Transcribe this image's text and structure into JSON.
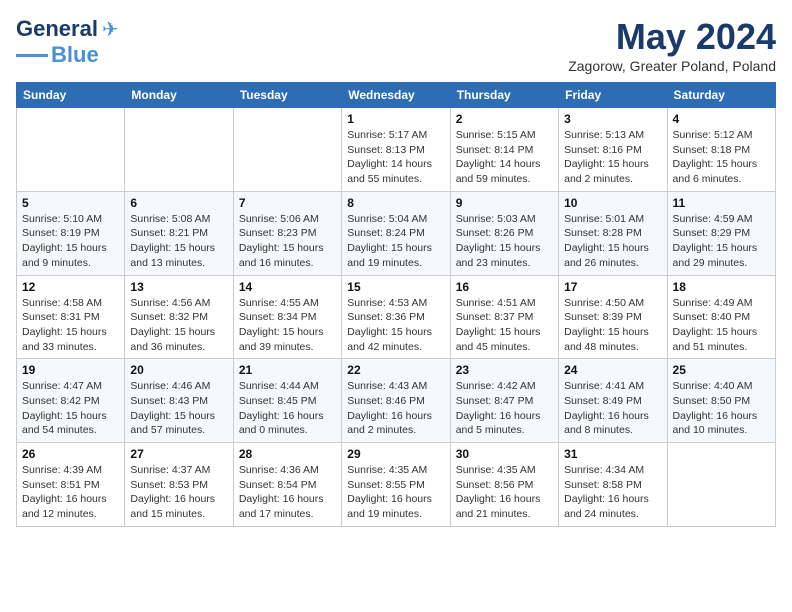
{
  "header": {
    "logo_general": "General",
    "logo_blue": "Blue",
    "month_title": "May 2024",
    "location": "Zagorow, Greater Poland, Poland"
  },
  "weekdays": [
    "Sunday",
    "Monday",
    "Tuesday",
    "Wednesday",
    "Thursday",
    "Friday",
    "Saturday"
  ],
  "weeks": [
    [
      {
        "day": "",
        "info": ""
      },
      {
        "day": "",
        "info": ""
      },
      {
        "day": "",
        "info": ""
      },
      {
        "day": "1",
        "info": "Sunrise: 5:17 AM\nSunset: 8:13 PM\nDaylight: 14 hours\nand 55 minutes."
      },
      {
        "day": "2",
        "info": "Sunrise: 5:15 AM\nSunset: 8:14 PM\nDaylight: 14 hours\nand 59 minutes."
      },
      {
        "day": "3",
        "info": "Sunrise: 5:13 AM\nSunset: 8:16 PM\nDaylight: 15 hours\nand 2 minutes."
      },
      {
        "day": "4",
        "info": "Sunrise: 5:12 AM\nSunset: 8:18 PM\nDaylight: 15 hours\nand 6 minutes."
      }
    ],
    [
      {
        "day": "5",
        "info": "Sunrise: 5:10 AM\nSunset: 8:19 PM\nDaylight: 15 hours\nand 9 minutes."
      },
      {
        "day": "6",
        "info": "Sunrise: 5:08 AM\nSunset: 8:21 PM\nDaylight: 15 hours\nand 13 minutes."
      },
      {
        "day": "7",
        "info": "Sunrise: 5:06 AM\nSunset: 8:23 PM\nDaylight: 15 hours\nand 16 minutes."
      },
      {
        "day": "8",
        "info": "Sunrise: 5:04 AM\nSunset: 8:24 PM\nDaylight: 15 hours\nand 19 minutes."
      },
      {
        "day": "9",
        "info": "Sunrise: 5:03 AM\nSunset: 8:26 PM\nDaylight: 15 hours\nand 23 minutes."
      },
      {
        "day": "10",
        "info": "Sunrise: 5:01 AM\nSunset: 8:28 PM\nDaylight: 15 hours\nand 26 minutes."
      },
      {
        "day": "11",
        "info": "Sunrise: 4:59 AM\nSunset: 8:29 PM\nDaylight: 15 hours\nand 29 minutes."
      }
    ],
    [
      {
        "day": "12",
        "info": "Sunrise: 4:58 AM\nSunset: 8:31 PM\nDaylight: 15 hours\nand 33 minutes."
      },
      {
        "day": "13",
        "info": "Sunrise: 4:56 AM\nSunset: 8:32 PM\nDaylight: 15 hours\nand 36 minutes."
      },
      {
        "day": "14",
        "info": "Sunrise: 4:55 AM\nSunset: 8:34 PM\nDaylight: 15 hours\nand 39 minutes."
      },
      {
        "day": "15",
        "info": "Sunrise: 4:53 AM\nSunset: 8:36 PM\nDaylight: 15 hours\nand 42 minutes."
      },
      {
        "day": "16",
        "info": "Sunrise: 4:51 AM\nSunset: 8:37 PM\nDaylight: 15 hours\nand 45 minutes."
      },
      {
        "day": "17",
        "info": "Sunrise: 4:50 AM\nSunset: 8:39 PM\nDaylight: 15 hours\nand 48 minutes."
      },
      {
        "day": "18",
        "info": "Sunrise: 4:49 AM\nSunset: 8:40 PM\nDaylight: 15 hours\nand 51 minutes."
      }
    ],
    [
      {
        "day": "19",
        "info": "Sunrise: 4:47 AM\nSunset: 8:42 PM\nDaylight: 15 hours\nand 54 minutes."
      },
      {
        "day": "20",
        "info": "Sunrise: 4:46 AM\nSunset: 8:43 PM\nDaylight: 15 hours\nand 57 minutes."
      },
      {
        "day": "21",
        "info": "Sunrise: 4:44 AM\nSunset: 8:45 PM\nDaylight: 16 hours\nand 0 minutes."
      },
      {
        "day": "22",
        "info": "Sunrise: 4:43 AM\nSunset: 8:46 PM\nDaylight: 16 hours\nand 2 minutes."
      },
      {
        "day": "23",
        "info": "Sunrise: 4:42 AM\nSunset: 8:47 PM\nDaylight: 16 hours\nand 5 minutes."
      },
      {
        "day": "24",
        "info": "Sunrise: 4:41 AM\nSunset: 8:49 PM\nDaylight: 16 hours\nand 8 minutes."
      },
      {
        "day": "25",
        "info": "Sunrise: 4:40 AM\nSunset: 8:50 PM\nDaylight: 16 hours\nand 10 minutes."
      }
    ],
    [
      {
        "day": "26",
        "info": "Sunrise: 4:39 AM\nSunset: 8:51 PM\nDaylight: 16 hours\nand 12 minutes."
      },
      {
        "day": "27",
        "info": "Sunrise: 4:37 AM\nSunset: 8:53 PM\nDaylight: 16 hours\nand 15 minutes."
      },
      {
        "day": "28",
        "info": "Sunrise: 4:36 AM\nSunset: 8:54 PM\nDaylight: 16 hours\nand 17 minutes."
      },
      {
        "day": "29",
        "info": "Sunrise: 4:35 AM\nSunset: 8:55 PM\nDaylight: 16 hours\nand 19 minutes."
      },
      {
        "day": "30",
        "info": "Sunrise: 4:35 AM\nSunset: 8:56 PM\nDaylight: 16 hours\nand 21 minutes."
      },
      {
        "day": "31",
        "info": "Sunrise: 4:34 AM\nSunset: 8:58 PM\nDaylight: 16 hours\nand 24 minutes."
      },
      {
        "day": "",
        "info": ""
      }
    ]
  ]
}
